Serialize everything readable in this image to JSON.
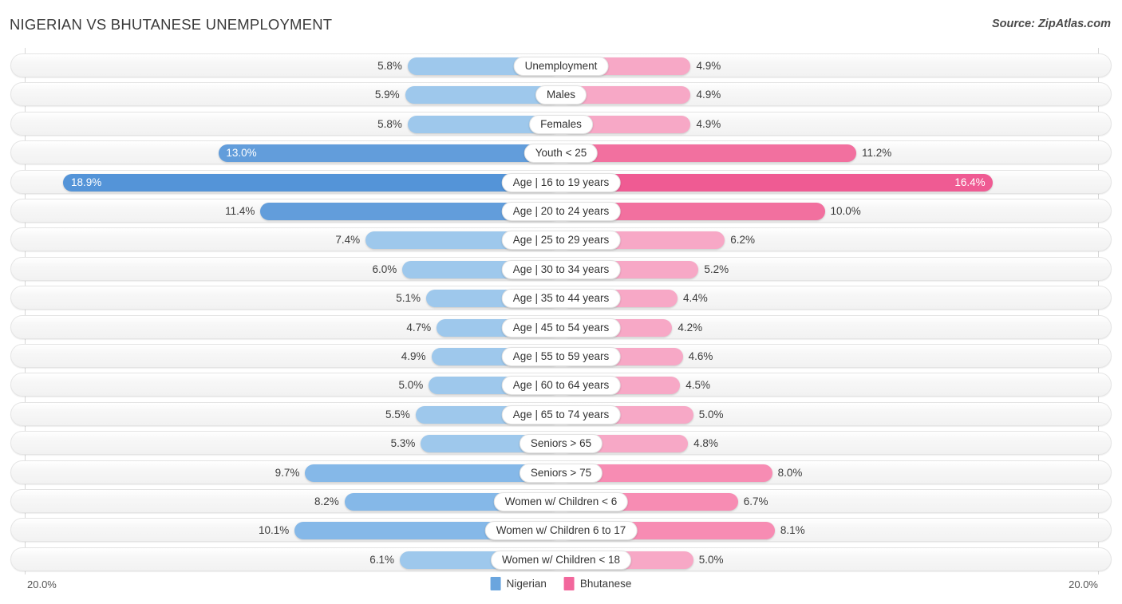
{
  "header": {
    "title": "NIGERIAN VS BHUTANESE UNEMPLOYMENT",
    "source": "Source: ZipAtlas.com"
  },
  "axis": {
    "left_label": "20.0%",
    "right_label": "20.0%",
    "max": 20.0
  },
  "legend": {
    "items": [
      {
        "label": "Nigerian",
        "color": "#6aa5de"
      },
      {
        "label": "Bhutanese",
        "color": "#f2679c"
      }
    ]
  },
  "colors": {
    "nigerian_light": "#9ec8ec",
    "nigerian_mid": "#85b8e8",
    "nigerian_dark": "#629ddb",
    "nigerian_darkest": "#5494d8",
    "bhutanese_light": "#f7a8c6",
    "bhutanese_mid": "#f78cb3",
    "bhutanese_dark": "#f2709f",
    "bhutanese_darkest": "#ef5b93",
    "track": "#f4f4f4",
    "gridline": "#d7d7d7"
  },
  "chart_data": {
    "type": "bar",
    "orientation": "horizontal-diverging",
    "title": "NIGERIAN VS BHUTANESE UNEMPLOYMENT",
    "xlabel": "",
    "ylabel": "",
    "xlim": [
      20.0,
      20.0
    ],
    "grid": true,
    "legend_position": "bottom-center",
    "categories": [
      "Unemployment",
      "Males",
      "Females",
      "Youth < 25",
      "Age | 16 to 19 years",
      "Age | 20 to 24 years",
      "Age | 25 to 29 years",
      "Age | 30 to 34 years",
      "Age | 35 to 44 years",
      "Age | 45 to 54 years",
      "Age | 55 to 59 years",
      "Age | 60 to 64 years",
      "Age | 65 to 74 years",
      "Seniors > 65",
      "Seniors > 75",
      "Women w/ Children < 6",
      "Women w/ Children 6 to 17",
      "Women w/ Children < 18"
    ],
    "series": [
      {
        "name": "Nigerian",
        "color": "#6aa5de",
        "values": [
          5.8,
          5.9,
          5.8,
          13.0,
          18.9,
          11.4,
          7.4,
          6.0,
          5.1,
          4.7,
          4.9,
          5.0,
          5.5,
          5.3,
          9.7,
          8.2,
          10.1,
          6.1
        ],
        "labels": [
          "5.8%",
          "5.9%",
          "5.8%",
          "13.0%",
          "18.9%",
          "11.4%",
          "7.4%",
          "6.0%",
          "5.1%",
          "4.7%",
          "4.9%",
          "5.0%",
          "5.5%",
          "5.3%",
          "9.7%",
          "8.2%",
          "10.1%",
          "6.1%"
        ]
      },
      {
        "name": "Bhutanese",
        "color": "#f2679c",
        "values": [
          4.9,
          4.9,
          4.9,
          11.2,
          16.4,
          10.0,
          6.2,
          5.2,
          4.4,
          4.2,
          4.6,
          4.5,
          5.0,
          4.8,
          8.0,
          6.7,
          8.1,
          5.0
        ],
        "labels": [
          "4.9%",
          "4.9%",
          "4.9%",
          "11.2%",
          "16.4%",
          "10.0%",
          "6.2%",
          "5.2%",
          "4.4%",
          "4.2%",
          "4.6%",
          "4.5%",
          "5.0%",
          "4.8%",
          "8.0%",
          "6.7%",
          "8.1%",
          "5.0%"
        ]
      }
    ]
  }
}
